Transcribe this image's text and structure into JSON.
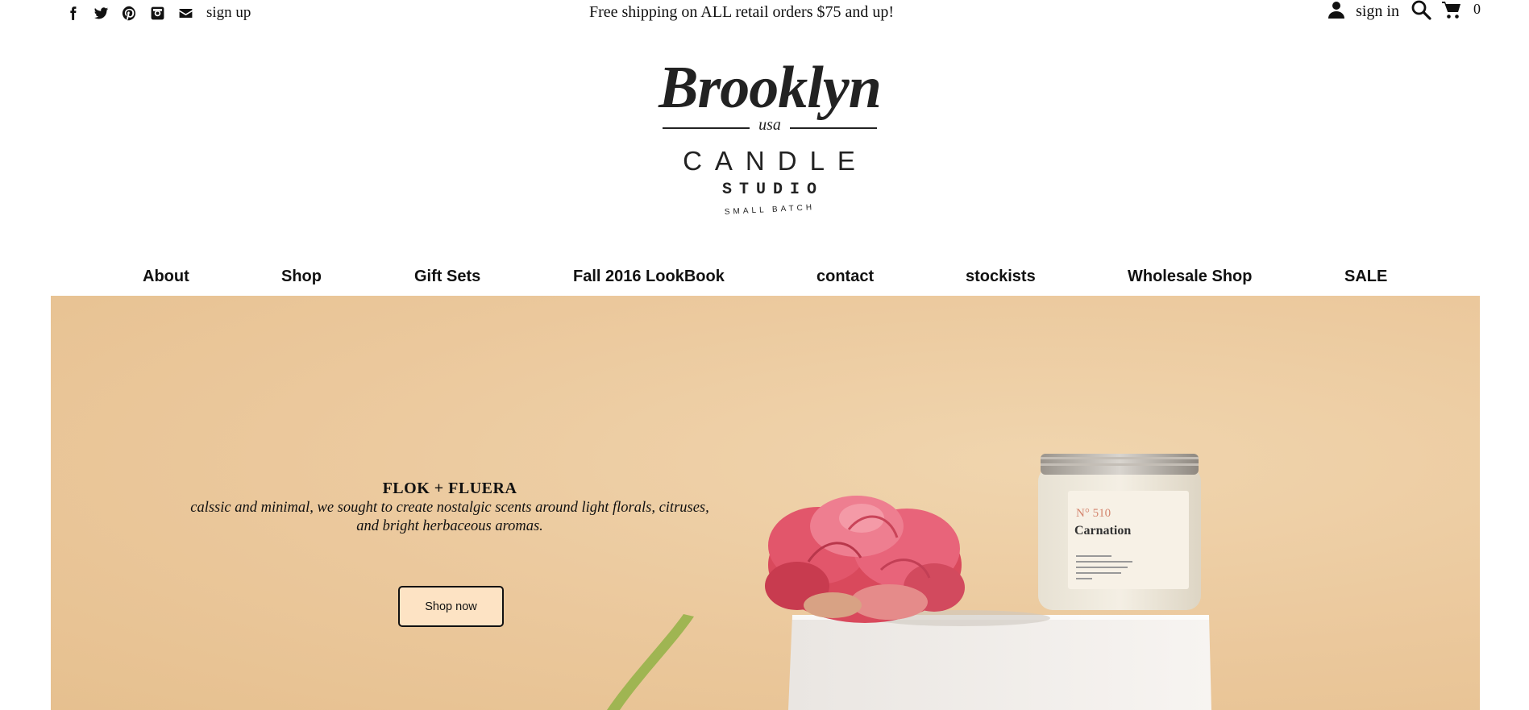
{
  "topbar": {
    "social_icons": [
      "facebook-icon",
      "twitter-icon",
      "pinterest-icon",
      "instagram-icon",
      "mail-icon"
    ],
    "signup_label": "sign up",
    "promo_text": "Free shipping on ALL retail orders $75 and up!",
    "signin_label": "sign in",
    "cart_count": "0"
  },
  "logo": {
    "script": "Brooklyn",
    "usa": "usa",
    "candle": "CANDLE",
    "studio": "STUDIO",
    "small_batch": "SMALL BATCH"
  },
  "nav": {
    "items": [
      {
        "label": "About"
      },
      {
        "label": "Shop"
      },
      {
        "label": "Gift Sets"
      },
      {
        "label": "Fall 2016 LookBook"
      },
      {
        "label": "contact"
      },
      {
        "label": "stockists"
      },
      {
        "label": "Wholesale Shop"
      },
      {
        "label": "SALE"
      }
    ]
  },
  "hero": {
    "title": "FLOK + FLUERA",
    "text": "calssic and minimal, we sought to create nostalgic scents around light florals, citruses, and bright herbaceous aromas.",
    "button_label": "Shop now",
    "jar_number": "N° 510",
    "jar_name": "Carnation",
    "colors": {
      "background": "#ebc89c",
      "button_fill": "#fde3c4",
      "flower": "#e0506a"
    }
  }
}
